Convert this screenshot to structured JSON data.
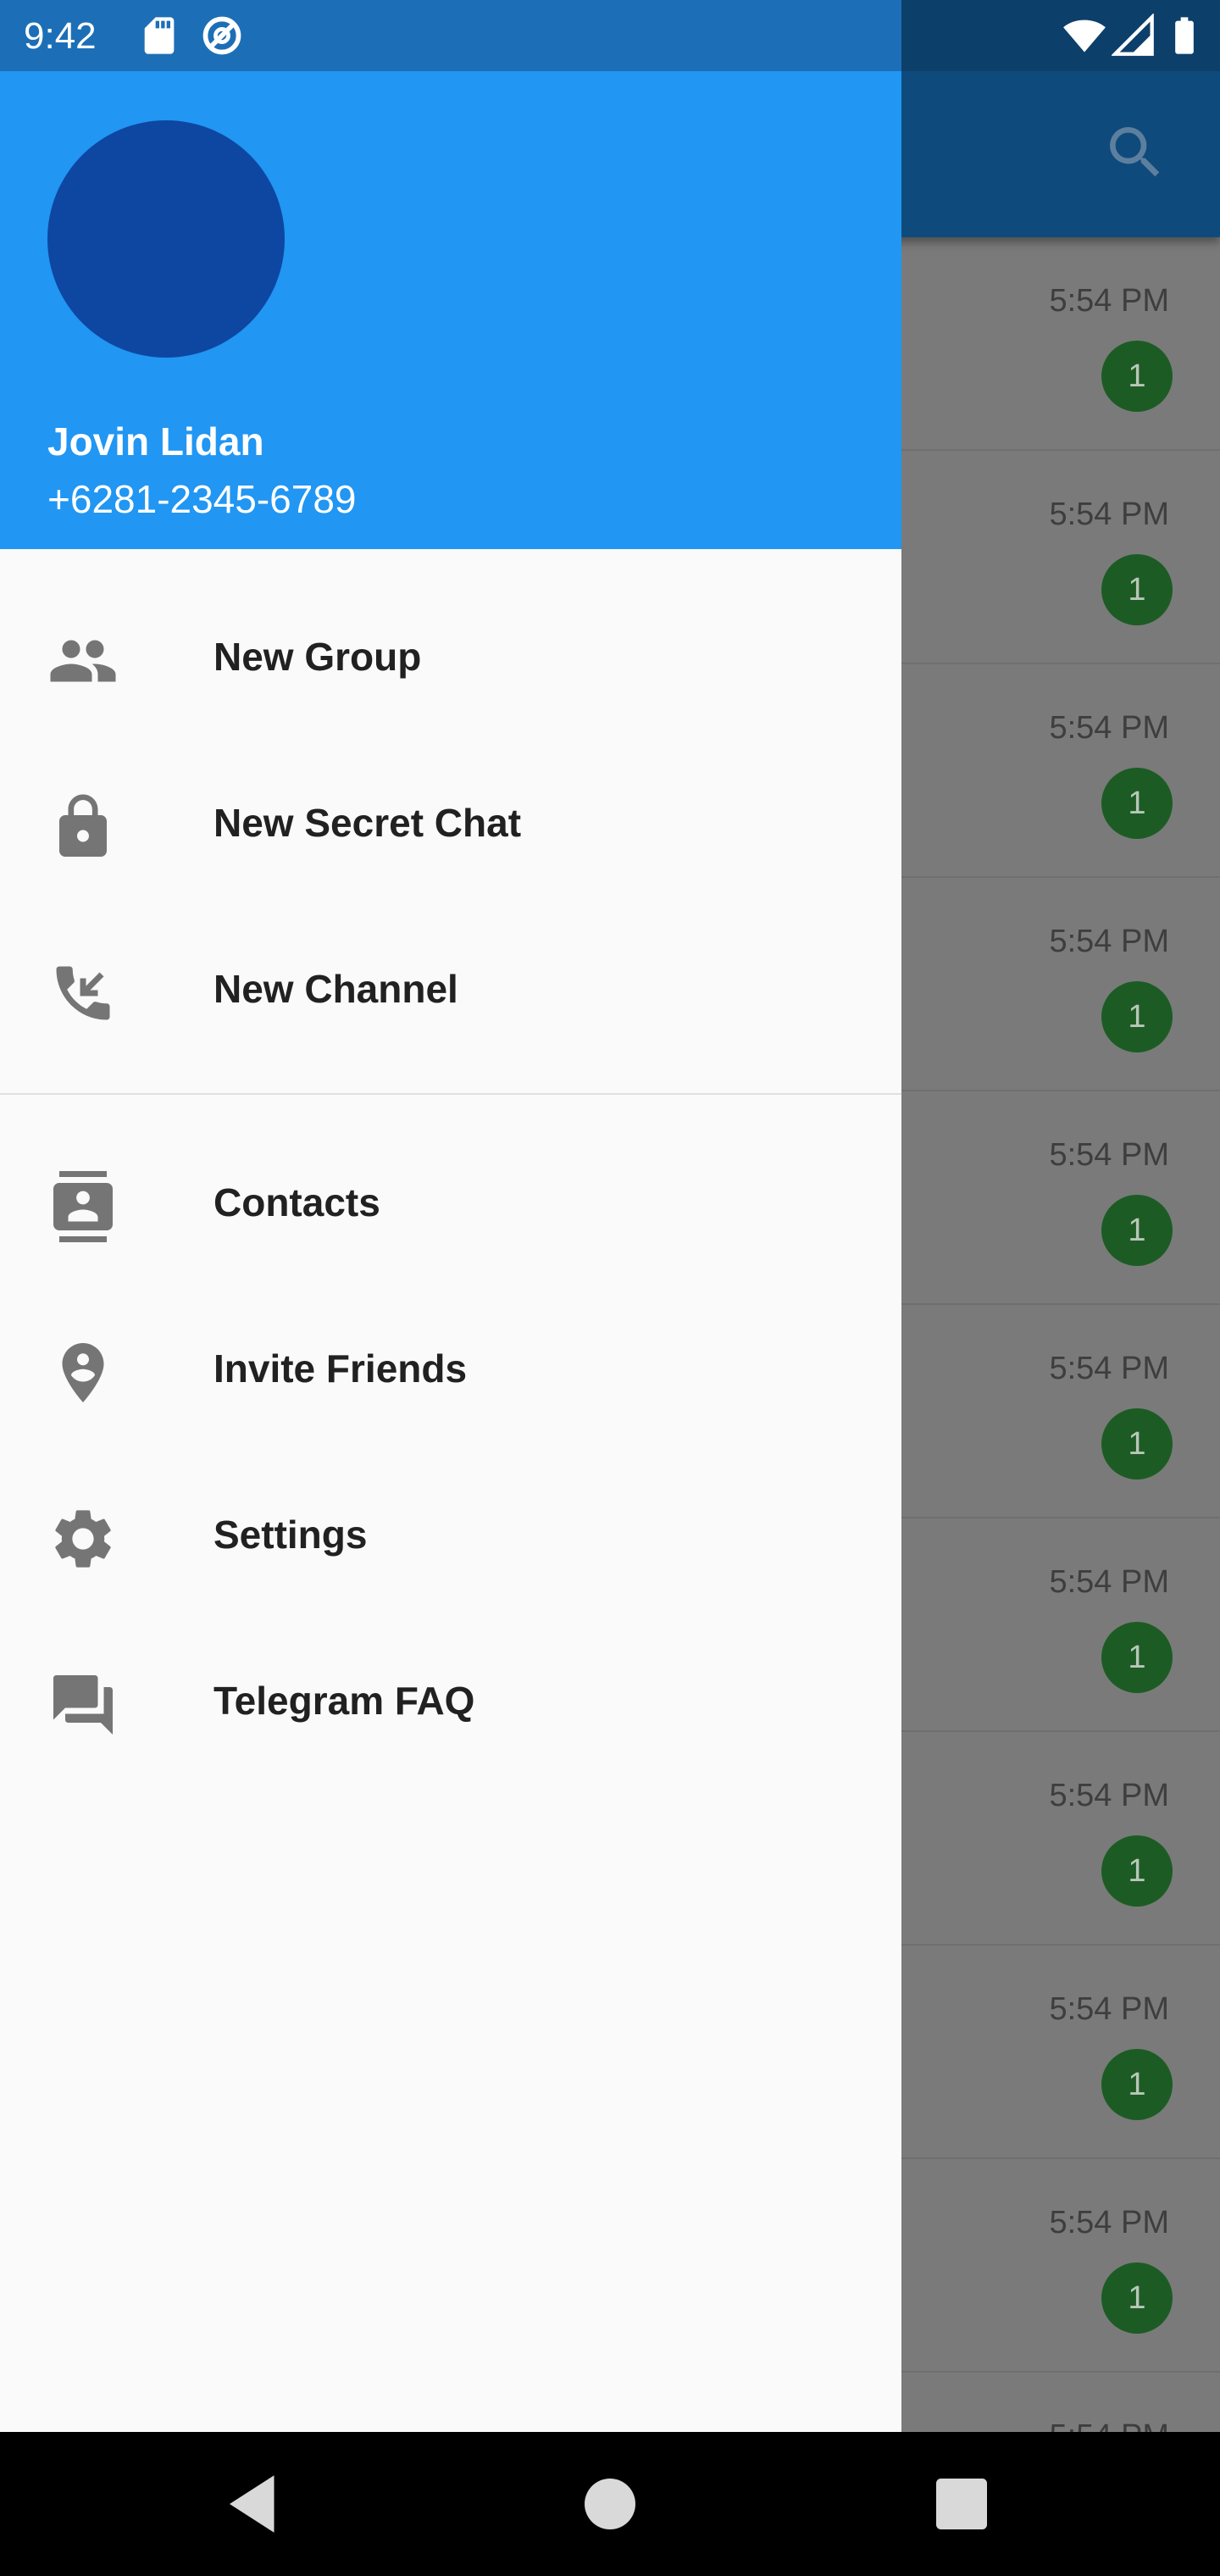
{
  "status_bar": {
    "time": "9:42",
    "left_icons": [
      "sd-card-icon",
      "data-saver-icon"
    ],
    "right_icons": [
      "wifi-icon",
      "cell-signal-icon",
      "battery-icon"
    ]
  },
  "app_bar": {
    "search_icon": "search-icon",
    "color": "#0f4a7c"
  },
  "chat_list": {
    "items": [
      {
        "time": "5:54 PM",
        "unread": "1"
      },
      {
        "time": "5:54 PM",
        "unread": "1"
      },
      {
        "time": "5:54 PM",
        "unread": "1"
      },
      {
        "time": "5:54 PM",
        "unread": "1"
      },
      {
        "time": "5:54 PM",
        "unread": "1"
      },
      {
        "time": "5:54 PM",
        "unread": "1"
      },
      {
        "time": "5:54 PM",
        "unread": "1"
      },
      {
        "time": "5:54 PM",
        "unread": "1"
      },
      {
        "time": "5:54 PM",
        "unread": "1"
      },
      {
        "time": "5:54 PM",
        "unread": "1"
      },
      {
        "time": "5:54 PM",
        "unread": ""
      }
    ]
  },
  "drawer": {
    "header_color": "#2196f3",
    "avatar_color": "#0d47a1",
    "user": {
      "name": "Jovin Lidan",
      "phone": "+6281-2345-6789"
    },
    "menu_group_1": [
      {
        "label": "New Group",
        "icon": "group-icon"
      },
      {
        "label": "New Secret Chat",
        "icon": "lock-icon"
      },
      {
        "label": "New Channel",
        "icon": "phone-incoming-icon"
      }
    ],
    "menu_group_2": [
      {
        "label": "Contacts",
        "icon": "contacts-icon"
      },
      {
        "label": "Invite Friends",
        "icon": "person-pin-icon"
      },
      {
        "label": "Settings",
        "icon": "gear-icon"
      },
      {
        "label": "Telegram FAQ",
        "icon": "forum-icon"
      }
    ]
  },
  "nav_bar": {
    "buttons": [
      "back-icon",
      "home-icon",
      "recents-icon"
    ]
  }
}
